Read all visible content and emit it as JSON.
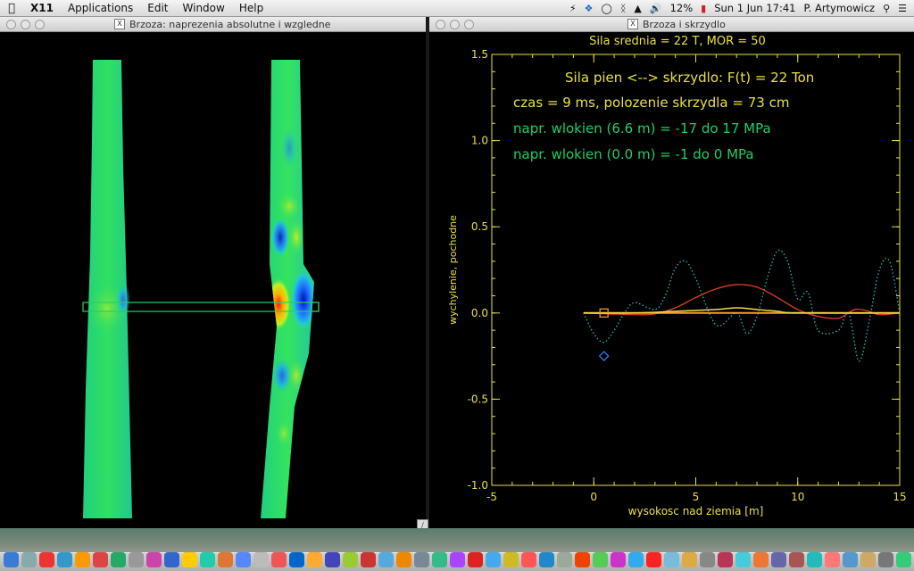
{
  "menubar": {
    "app": "X11",
    "menus": [
      "Applications",
      "Edit",
      "Window",
      "Help"
    ],
    "battery": "12%",
    "clock": "Sun 1 Jun  17:41",
    "user": "P. Artymowicz"
  },
  "left_window": {
    "title": "Brzoza: naprezenia absolutne i wzgledne"
  },
  "right_window": {
    "title": "Brzoza i skrzydlo",
    "header": "Sila srednia = 22 T,    MOR = 50",
    "line1": "Sila pien <--> skrzydlo: F(t) = 22 Ton",
    "line2": "czas = 9 ms,   polozenie skrzydla = 73 cm",
    "line3": "napr. wlokien (6.6 m) =   -17   do  17 MPa",
    "line4": "napr. wlokien (0.0 m) =   -1    do  0 MPa"
  },
  "chart_data": {
    "type": "line",
    "xlabel": "wysokosc nad ziemia [m]",
    "ylabel": "wychylenie, pochodne",
    "xlim": [
      -5,
      15
    ],
    "ylim": [
      -1.0,
      1.5
    ],
    "xticks": [
      "-5",
      "0",
      "5",
      "10",
      "15"
    ],
    "yticks": [
      "-1.0",
      "-0.5",
      "0.0",
      "0.5",
      "1.0",
      "1.5"
    ],
    "colors": {
      "axes": "#e8e040",
      "text_yellow": "#e8e040",
      "text_green": "#22cc66",
      "red": "#e04020",
      "cyan": "#2ab8b8",
      "yellow_line": "#f0e040",
      "orange_line": "#ff9a20"
    },
    "series": [
      {
        "style": "orange-flat",
        "x": [
          -0.5,
          15
        ],
        "y": [
          0.0,
          0.0
        ]
      },
      {
        "style": "red",
        "x": [
          -0.5,
          2,
          3,
          4,
          5,
          6,
          7,
          8,
          9,
          10,
          11,
          12,
          12.8,
          13.5,
          14,
          15
        ],
        "y": [
          0.0,
          -0.01,
          -0.005,
          0.03,
          0.09,
          0.14,
          0.165,
          0.15,
          0.09,
          0.02,
          -0.02,
          -0.03,
          0.02,
          0.01,
          -0.01,
          0.0
        ]
      },
      {
        "style": "yellow",
        "x": [
          -0.5,
          2,
          4,
          6,
          7,
          8,
          9,
          10,
          15
        ],
        "y": [
          0.0,
          0.0,
          0.01,
          0.02,
          0.03,
          0.02,
          0.01,
          0.0,
          0.0
        ]
      },
      {
        "style": "cyan-dotted",
        "x": [
          -0.5,
          0,
          0.5,
          1,
          1.5,
          2,
          3,
          3.5,
          4,
          4.5,
          5,
          6,
          7,
          7.5,
          8,
          8.5,
          9,
          9.5,
          10,
          10.5,
          11,
          12,
          12.5,
          13,
          13.5,
          14,
          14.5,
          15
        ],
        "y": [
          0.0,
          -0.12,
          -0.17,
          -0.1,
          0.0,
          0.06,
          0.02,
          0.1,
          0.26,
          0.3,
          0.2,
          -0.07,
          0.0,
          -0.12,
          -0.02,
          0.2,
          0.36,
          0.3,
          0.08,
          0.12,
          -0.1,
          -0.1,
          0.0,
          -0.28,
          -0.05,
          0.25,
          0.3,
          0.0
        ]
      }
    ],
    "markers": [
      {
        "shape": "square",
        "color": "#ffa020",
        "x": 0.5,
        "y": 0.0
      },
      {
        "shape": "diamond",
        "color": "#3080ff",
        "x": 0.5,
        "y": -0.25
      }
    ]
  }
}
